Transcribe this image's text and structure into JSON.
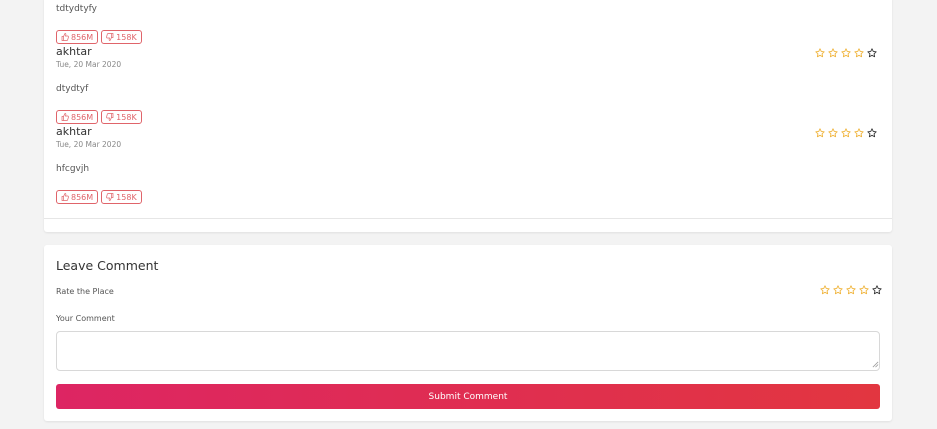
{
  "reviews": [
    {
      "text": "tdtydtyfy",
      "likes": "856M",
      "dislikes": "158K"
    },
    {
      "author": "akhtar",
      "date": "Tue, 20 Mar 2020",
      "rating": 4,
      "text": "dtydtyf",
      "likes": "856M",
      "dislikes": "158K"
    },
    {
      "author": "akhtar",
      "date": "Tue, 20 Mar 2020",
      "rating": 4,
      "text": "hfcgvjh",
      "likes": "856M",
      "dislikes": "158K"
    }
  ],
  "comment_form": {
    "title": "Leave Comment",
    "rate_label": "Rate the Place",
    "rating": 4,
    "comment_label": "Your Comment",
    "comment_value": "",
    "submit_label": "Submit Comment"
  },
  "colors": {
    "star_filled": "#f0b43c",
    "star_empty": "#333333",
    "vote_accent": "#e0646a",
    "submit_gradient_start": "#dd2563",
    "submit_gradient_end": "#e23640"
  },
  "icons": {
    "like": "thumbs-up-icon",
    "dislike": "thumbs-down-icon",
    "star": "star-icon"
  }
}
